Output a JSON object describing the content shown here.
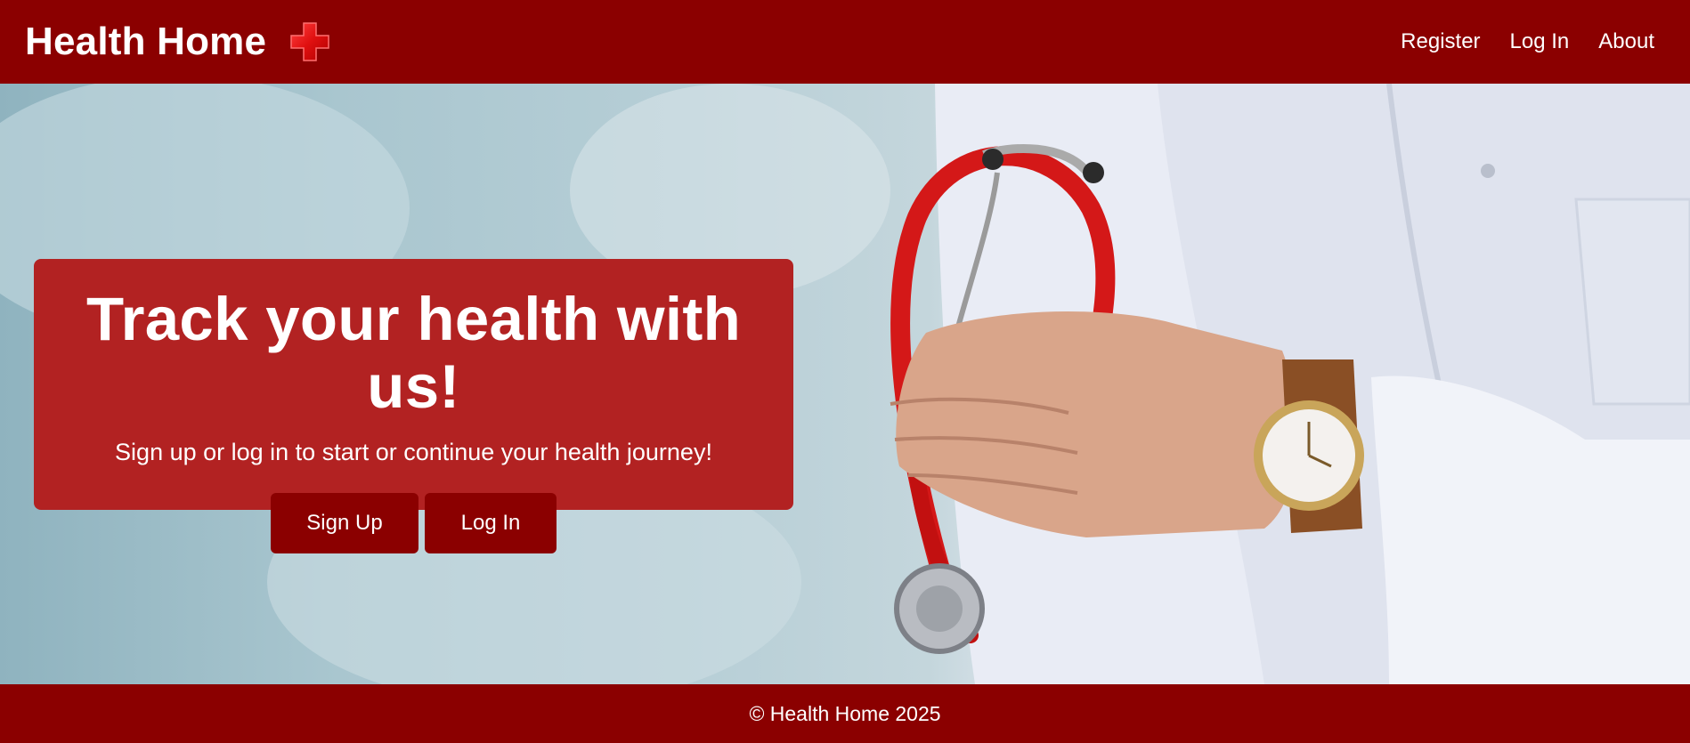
{
  "header": {
    "brand_title": "Health Home",
    "brand_icon": "medical-cross-icon",
    "nav": [
      {
        "label": "Register"
      },
      {
        "label": "Log In"
      },
      {
        "label": "About"
      }
    ]
  },
  "hero": {
    "heading": "Track your health with us!",
    "subheading": "Sign up or log in to start or continue your health journey!",
    "signup_label": "Sign Up",
    "login_label": "Log In",
    "background_image": "doctor-with-stethoscope-photo"
  },
  "footer": {
    "copyright": "© Health Home 2025"
  },
  "colors": {
    "primary": "#8b0000",
    "card": "#b22222",
    "text": "#ffffff"
  }
}
